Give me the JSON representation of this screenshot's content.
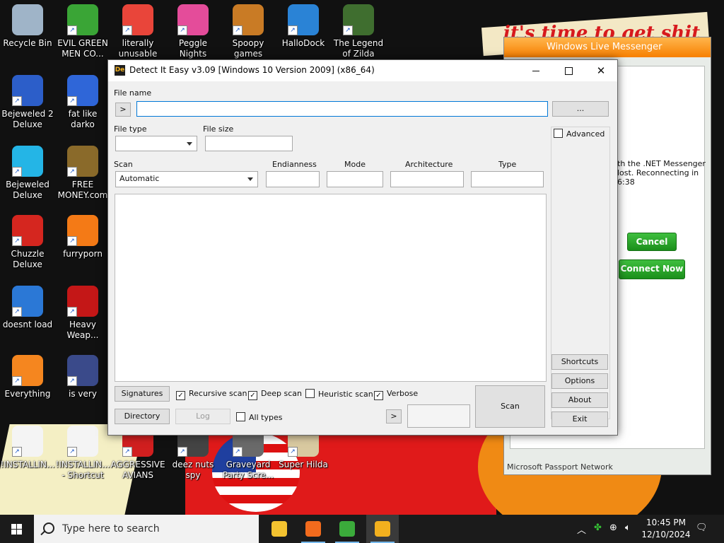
{
  "desktop": {
    "slogan": "it's time to get shit",
    "icons": [
      {
        "label": "Recycle Bin",
        "color": "#9fb4c8"
      },
      {
        "label": "EVIL GREEN MEN CO...",
        "color": "#3aa536"
      },
      {
        "label": "literally unusable",
        "color": "#e9453a"
      },
      {
        "label": "Peggle Nights Deluxe",
        "color": "#e44c9a"
      },
      {
        "label": "Spoopy games",
        "color": "#c97b25"
      },
      {
        "label": "HalloDock",
        "color": "#2a83d6"
      },
      {
        "label": "The Legend of Zilda",
        "color": "#3f6e2f"
      },
      {
        "label": "Bejeweled 2 Deluxe",
        "color": "#2c5ec9"
      },
      {
        "label": "fat like darko",
        "color": "#2f66d8"
      },
      {
        "label": "Bejeweled Deluxe",
        "color": "#24b5e6"
      },
      {
        "label": "FREE MONEY.com",
        "color": "#8a6a2a"
      },
      {
        "label": "Chuzzle Deluxe",
        "color": "#d5261f"
      },
      {
        "label": "furryporn",
        "color": "#f47a16"
      },
      {
        "label": "doesnt load",
        "color": "#2b78d6"
      },
      {
        "label": "Heavy Weap...",
        "color": "#c41717"
      },
      {
        "label": "Everything",
        "color": "#f5861f"
      },
      {
        "label": "is very",
        "color": "#3a4a8a"
      },
      {
        "label": "!INSTALLIN...",
        "color": "#f4f4f4"
      },
      {
        "label": "!INSTALLIN... - Shortcut",
        "color": "#f4f4f4"
      },
      {
        "label": "AGGRESSIVE AVIANS",
        "color": "#d11f1f"
      },
      {
        "label": "deez nuts spy",
        "color": "#444444"
      },
      {
        "label": "Graveyard Party Scre...",
        "color": "#6a6a6a"
      },
      {
        "label": "Super Hilda",
        "color": "#d9c9a0"
      }
    ]
  },
  "messenger": {
    "title": "Windows Live Messenger",
    "message": "th the .NET Messenger lost. Reconnecting in 6:38",
    "cancel_label": "Cancel",
    "connect_label": "Connect Now",
    "footer": "Microsoft Passport Network"
  },
  "die": {
    "title": "Detect It Easy v3.09 [Windows 10 Version 2009] (x86_64)",
    "icon_text": "De",
    "file_name_label": "File name",
    "arrow_btn": ">",
    "file_name_value": "",
    "browse_btn": "...",
    "file_type_label": "File type",
    "file_size_label": "File size",
    "advanced_label": "Advanced",
    "scan_label": "Scan",
    "scan_value": "Automatic",
    "endianness_label": "Endianness",
    "mode_label": "Mode",
    "architecture_label": "Architecture",
    "type_label": "Type",
    "shortcuts_btn": "Shortcuts",
    "options_btn": "Options",
    "about_btn": "About",
    "exit_btn": "Exit",
    "signatures_btn": "Signatures",
    "recursive_label": "Recursive scan",
    "deep_label": "Deep scan",
    "heuristic_label": "Heuristic scan",
    "verbose_label": "Verbose",
    "directory_btn": "Directory",
    "log_btn": "Log",
    "alltypes_label": "All types",
    "next_btn": ">",
    "scan_btn": "Scan",
    "recursive_checked": "✓",
    "deep_checked": "✓",
    "verbose_checked": "✓"
  },
  "taskbar": {
    "search_placeholder": "Type here to search",
    "time": "10:45 PM",
    "date": "12/10/2024",
    "apps": [
      {
        "name": "file-explorer",
        "color": "#f3c230"
      },
      {
        "name": "firefox",
        "color": "#f26b1d"
      },
      {
        "name": "messenger",
        "color": "#3bab3b"
      },
      {
        "name": "detect-it-easy",
        "color": "#f2b01e"
      }
    ]
  }
}
